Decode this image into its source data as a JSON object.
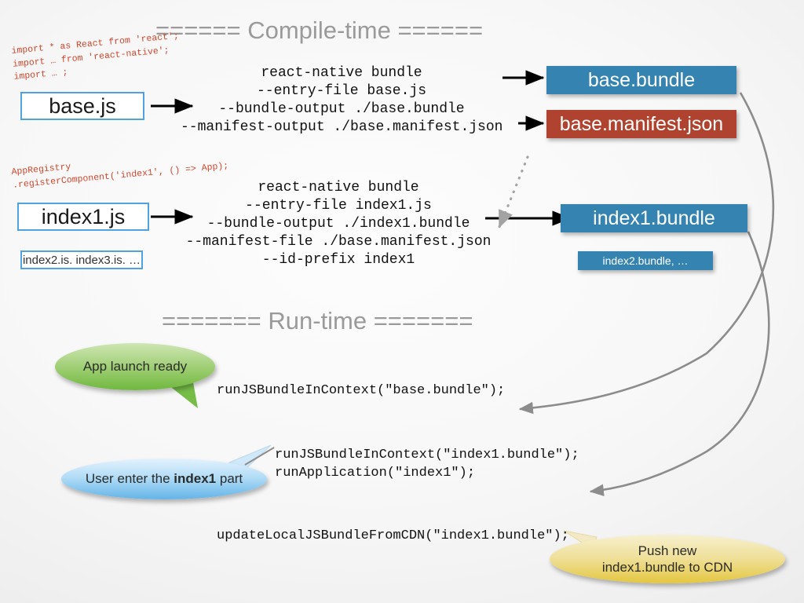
{
  "sections": {
    "compile_header": "====== Compile-time ======",
    "runtime_header": "======= Run-time =======",
    "header_color": "#9a9a9a"
  },
  "compile_time": {
    "base": {
      "source_annotation": "import * as React from 'react';\nimport … from 'react-native';\nimport … ;",
      "file_label": "base.js",
      "command": "react-native bundle\n--entry-file base.js\n--bundle-output ./base.bundle\n--manifest-output ./base.manifest.json",
      "outputs": [
        {
          "label": "base.bundle",
          "color": "#3583b0"
        },
        {
          "label": "base.manifest.json",
          "color": "#b0432f"
        }
      ]
    },
    "index1": {
      "source_annotation": "AppRegistry\n.registerComponent('index1', () => App);",
      "file_label": "index1.js",
      "more_files_label": "index2.is. index3.is. …",
      "command": "react-native bundle\n--entry-file index1.js\n--bundle-output ./index1.bundle\n--manifest-file ./base.manifest.json\n--id-prefix index1",
      "outputs": [
        {
          "label": "index1.bundle",
          "color": "#3583b0"
        },
        {
          "label": "index2.bundle, …",
          "color": "#3583b0"
        }
      ]
    }
  },
  "run_time": {
    "steps": [
      {
        "code": "runJSBundleInContext(\"base.bundle\");",
        "bubble": "App launch ready",
        "bubble_color": "#9ccd70"
      },
      {
        "code": "runJSBundleInContext(\"index1.bundle\");\nrunApplication(\"index1\");",
        "bubble_prefix": "User enter the ",
        "bubble_bold": "index1",
        "bubble_suffix": " part",
        "bubble_color": "#63b4e8"
      },
      {
        "code": "updateLocalJSBundleFromCDN(\"index1.bundle\");",
        "bubble_line1": "Push new",
        "bubble_line2": "index1.bundle to CDN",
        "bubble_color": "#e4c63f"
      }
    ]
  },
  "connectors": {
    "arrow_color_solid": "#000000",
    "arrow_color_curve": "#8c8c8c",
    "arrow_color_dotted": "#9e9e9e"
  }
}
